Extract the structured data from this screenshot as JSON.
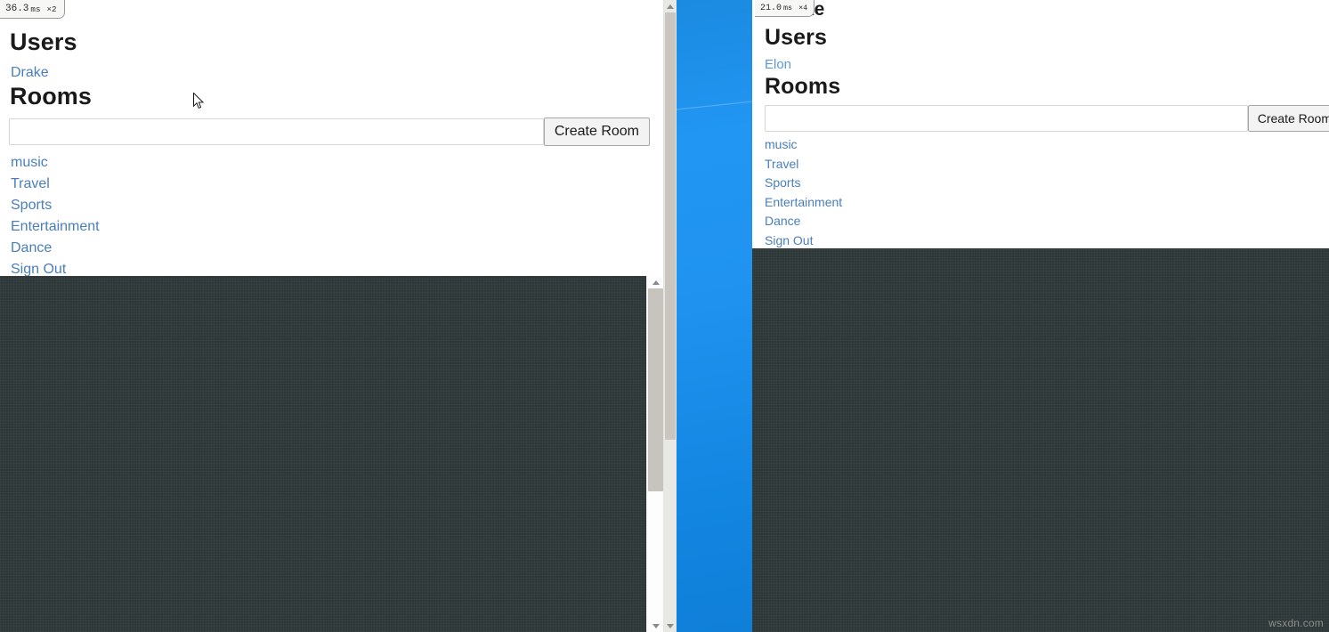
{
  "app": {
    "watermark": "wsxdn.com",
    "link_color": "#4a7ebb",
    "link_color_light": "#5b9bd5",
    "heading_color": "#1a1a1a",
    "desktop_accent": "#2196f3",
    "dark_region_color": "#2e3838"
  },
  "left_panel": {
    "perf_badge": {
      "time": "36.3",
      "unit": "ms",
      "count": "×2"
    },
    "users_heading": "Users",
    "users": [
      {
        "name": "Drake"
      }
    ],
    "rooms_heading": "Rooms",
    "room_input": {
      "value": "",
      "placeholder": ""
    },
    "create_room_label": "Create Room",
    "rooms": [
      {
        "name": "music"
      },
      {
        "name": "Travel"
      },
      {
        "name": "Sports"
      },
      {
        "name": "Entertainment"
      },
      {
        "name": "Dance"
      }
    ],
    "sign_out_label": "Sign Out"
  },
  "right_panel": {
    "perf_badge": {
      "time": "21.0",
      "unit": "ms",
      "count": "×4"
    },
    "occluded_username": "ke",
    "users_heading": "Users",
    "users": [
      {
        "name": "Elon"
      }
    ],
    "rooms_heading": "Rooms",
    "room_input": {
      "value": "",
      "placeholder": ""
    },
    "create_room_label": "Create Room",
    "rooms": [
      {
        "name": "music"
      },
      {
        "name": "Travel"
      },
      {
        "name": "Sports"
      },
      {
        "name": "Entertainment"
      },
      {
        "name": "Dance"
      }
    ],
    "sign_out_label": "Sign Out"
  }
}
